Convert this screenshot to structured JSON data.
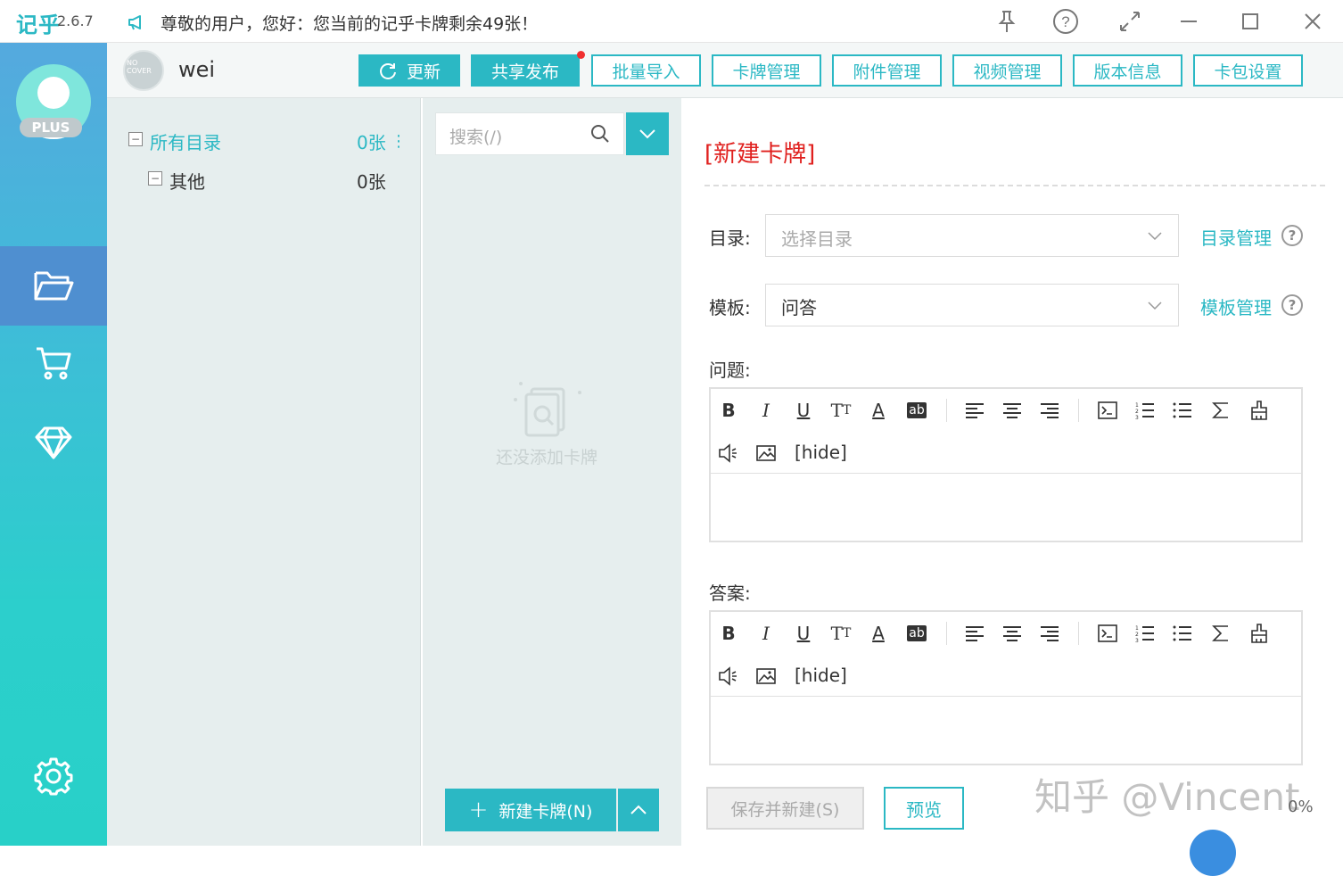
{
  "app": {
    "logo": "记乎",
    "version": "2.6.7"
  },
  "notice": "尊敬的用户，您好：您当前的记乎卡牌剩余49张！",
  "sidebar": {
    "badge": "PLUS"
  },
  "user": {
    "name": "wei",
    "avatar_text": "NO COVER"
  },
  "toolbar": {
    "update": "更新",
    "share": "共享发布",
    "batch_import": "批量导入",
    "card_manage": "卡牌管理",
    "attach_manage": "附件管理",
    "video_manage": "视频管理",
    "version_info": "版本信息",
    "pack_settings": "卡包设置"
  },
  "tree": {
    "items": [
      {
        "label": "所有目录",
        "count": "0张"
      },
      {
        "label": "其他",
        "count": "0张"
      }
    ]
  },
  "list": {
    "search_placeholder": "搜索(/)",
    "empty_text": "还没添加卡牌",
    "new_card": "新建卡牌(N)"
  },
  "editor": {
    "title": "[新建卡牌]",
    "dir_label": "目录:",
    "dir_placeholder": "选择目录",
    "dir_manage": "目录管理",
    "template_label": "模板:",
    "template_value": "问答",
    "template_manage": "模板管理",
    "question_label": "问题:",
    "answer_label": "答案:",
    "hide_tag": "[hide]",
    "save_new": "保存并新建(S)",
    "preview": "预览"
  },
  "progress": "0%",
  "watermark": "知乎 @Vincent",
  "colors": {
    "accent": "#2bb8c4",
    "title_red": "#e0201e",
    "nav_active": "#4f8fd0"
  }
}
